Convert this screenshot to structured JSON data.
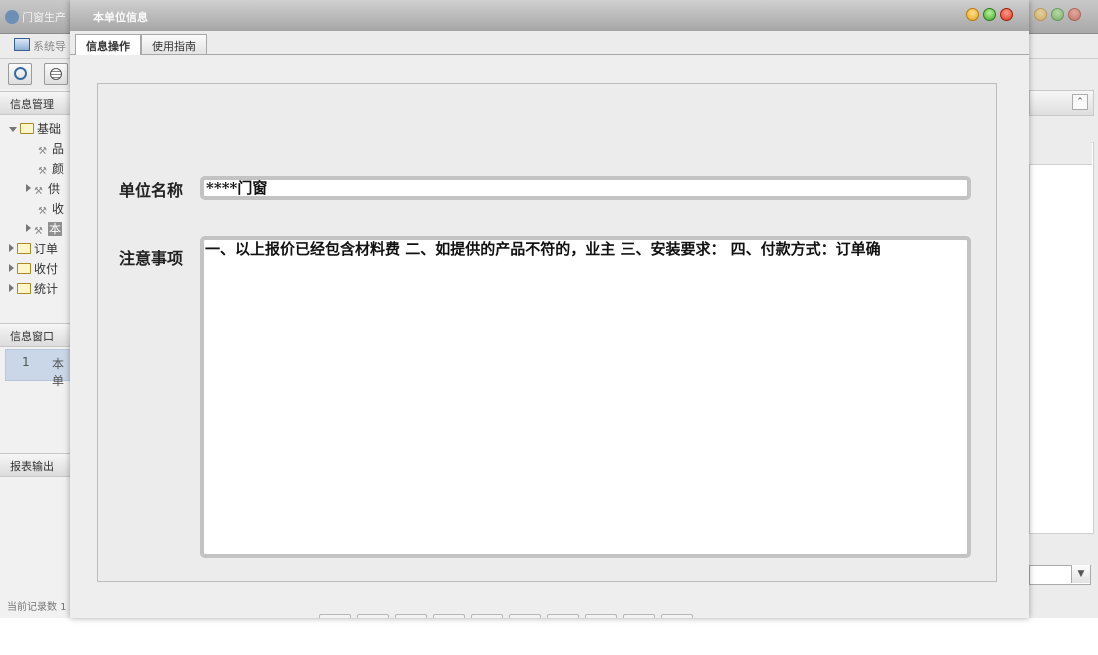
{
  "app": {
    "title": "门窗生产",
    "nav_label": "系统导",
    "status": "当前记录数 1"
  },
  "sidebar": {
    "section_info_mgmt": "信息管理",
    "tree": [
      {
        "label": "基础",
        "type": "folder",
        "expanded": true
      },
      {
        "label": "品",
        "type": "leaf"
      },
      {
        "label": "颜",
        "type": "leaf"
      },
      {
        "label": "供",
        "type": "leaf",
        "collapsed": true
      },
      {
        "label": "收",
        "type": "leaf"
      },
      {
        "label": "本",
        "type": "leaf",
        "collapsed": true,
        "selected": true
      },
      {
        "label": "订单",
        "type": "folder"
      },
      {
        "label": "收付",
        "type": "folder"
      },
      {
        "label": "统计",
        "type": "folder"
      }
    ],
    "section_info_window": "信息窗口",
    "window_row": {
      "index": "1",
      "label": "本单"
    },
    "section_report": "报表输出"
  },
  "dialog": {
    "title": "本单位信息",
    "tabs": [
      {
        "label": "信息操作",
        "active": true
      },
      {
        "label": "使用指南",
        "active": false
      }
    ],
    "fields": {
      "unit_name_label": "单位名称",
      "unit_name_value": "****门窗",
      "notes_label": "注意事项",
      "notes_value": "一、以上报价已经包含材料费  二、如提供的产品不符的，业主  三、安装要求：  四、付款方式：订单确"
    }
  },
  "colors": {
    "selection": "#c9d7e8",
    "titlebar": "#a9a9a9",
    "close_red": "#d63a22",
    "minimize_yellow": "#e8a21e",
    "maximize_green": "#44a82a"
  }
}
